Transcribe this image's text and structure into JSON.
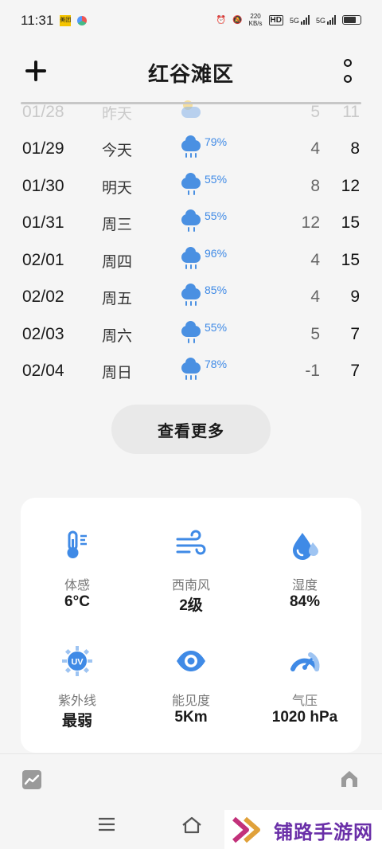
{
  "status_bar": {
    "time": "11:31",
    "app_badge": "美团",
    "net_speed": "220",
    "net_unit": "KB/s",
    "hd": "HD",
    "sim1": "5G",
    "sim2": "5G"
  },
  "header": {
    "title": "红谷滩区"
  },
  "forecast": [
    {
      "date": "01/28",
      "day": "昨天",
      "icon": "partly-cloudy-icon",
      "pct": "",
      "low": "5",
      "high": "11",
      "past": true
    },
    {
      "date": "01/29",
      "day": "今天",
      "icon": "rain-icon",
      "pct": "79%",
      "low": "4",
      "high": "8",
      "past": false
    },
    {
      "date": "01/30",
      "day": "明天",
      "icon": "rain-icon",
      "pct": "55%",
      "low": "8",
      "high": "12",
      "past": false
    },
    {
      "date": "01/31",
      "day": "周三",
      "icon": "rain-icon",
      "pct": "55%",
      "low": "12",
      "high": "15",
      "past": false
    },
    {
      "date": "02/01",
      "day": "周四",
      "icon": "rain-icon",
      "pct": "96%",
      "low": "4",
      "high": "15",
      "past": false
    },
    {
      "date": "02/02",
      "day": "周五",
      "icon": "rain-icon",
      "pct": "85%",
      "low": "4",
      "high": "9",
      "past": false
    },
    {
      "date": "02/03",
      "day": "周六",
      "icon": "rain-icon",
      "pct": "55%",
      "low": "5",
      "high": "7",
      "past": false
    },
    {
      "date": "02/04",
      "day": "周日",
      "icon": "rain-icon",
      "pct": "78%",
      "low": "-1",
      "high": "7",
      "past": false
    }
  ],
  "more_button": "查看更多",
  "details": [
    {
      "label": "体感",
      "value": "6°C",
      "icon": "thermometer-icon"
    },
    {
      "label": "西南风",
      "value": "2级",
      "icon": "wind-icon"
    },
    {
      "label": "湿度",
      "value": "84%",
      "icon": "humidity-icon"
    },
    {
      "label": "紫外线",
      "value": "最弱",
      "icon": "uv-icon",
      "icon_text": "UV"
    },
    {
      "label": "能见度",
      "value": "5Km",
      "icon": "visibility-icon"
    },
    {
      "label": "气压",
      "value": "1020 hPa",
      "icon": "pressure-icon"
    }
  ],
  "watermark": "铺路手游网",
  "colors": {
    "accent": "#4a90e2",
    "precip_text": "#3f8ae6",
    "background": "#f5f5f5",
    "card": "#ffffff"
  }
}
